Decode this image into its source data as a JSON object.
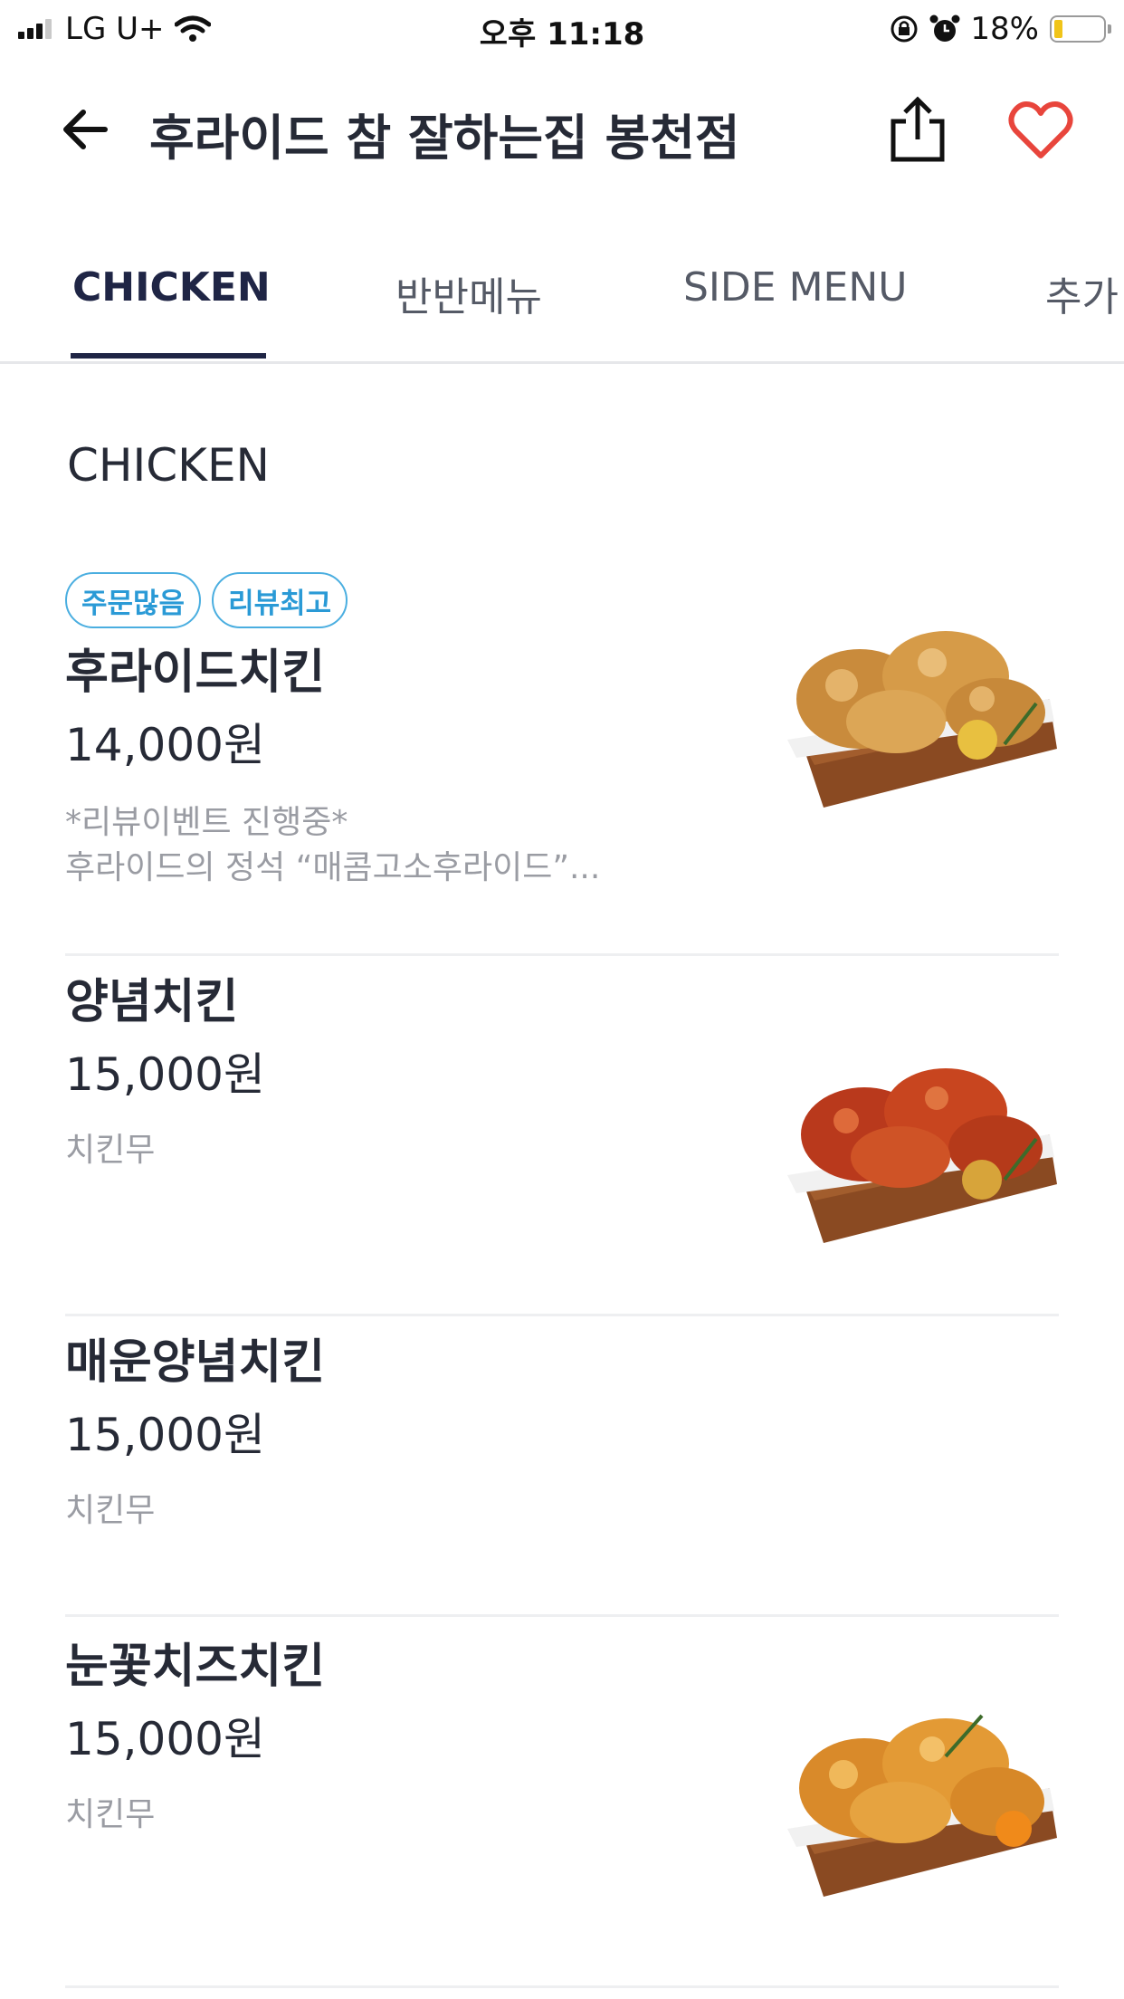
{
  "status_bar": {
    "carrier": "LG U+",
    "time": "오후 11:18",
    "battery_percent": "18%",
    "battery_level": 0.18
  },
  "header": {
    "title": "후라이드 참 잘하는집 봉천점",
    "icons": [
      "back-arrow-icon",
      "share-icon",
      "heart-icon"
    ],
    "favorite_color": "#e8453c"
  },
  "tabs": [
    {
      "label": "CHICKEN",
      "active": true
    },
    {
      "label": "반반메뉴",
      "active": false
    },
    {
      "label": "SIDE MENU",
      "active": false
    },
    {
      "label": "추가",
      "active": false
    }
  ],
  "section": {
    "title": "CHICKEN"
  },
  "menu_items": [
    {
      "badges": [
        "주문많음",
        "리뷰최고"
      ],
      "name": "후라이드치킨",
      "price": "14,000원",
      "desc_line1": "*리뷰이벤트 진행중*",
      "desc_line2": "후라이드의 정석 “매콤고소후라이드”...",
      "image": "fried-chicken"
    },
    {
      "name": "양념치킨",
      "price": "15,000원",
      "desc_line1": "치킨무",
      "image": "seasoned-chicken"
    },
    {
      "name": "매운양념치킨",
      "price": "15,000원",
      "desc_line1": "치킨무"
    },
    {
      "name": "눈꽃치즈치킨",
      "price": "15,000원",
      "desc_line1": "치킨무",
      "image": "snow-cheese-chicken"
    }
  ],
  "colors": {
    "accent": "#1f2545",
    "badge": "#2a9ad6",
    "heart": "#e8453c"
  }
}
